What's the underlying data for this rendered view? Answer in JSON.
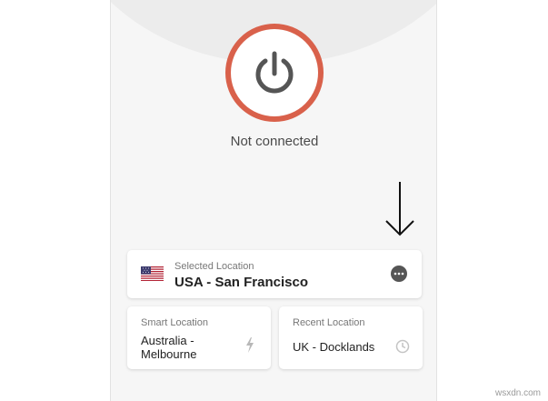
{
  "status": {
    "text": "Not connected"
  },
  "selected_location": {
    "label": "Selected Location",
    "value": "USA - San Francisco",
    "flag": "us-flag-icon"
  },
  "smart_location": {
    "label": "Smart Location",
    "value": "Australia - Melbourne",
    "icon": "bolt-icon"
  },
  "recent_location": {
    "label": "Recent Location",
    "value": "UK - Docklands",
    "icon": "clock-icon"
  },
  "watermark": {
    "text": "wsxdn.com"
  },
  "colors": {
    "power_ring": "#d9614b",
    "power_icon": "#555555",
    "panel_background": "#f6f6f6",
    "card_background": "#ffffff"
  }
}
